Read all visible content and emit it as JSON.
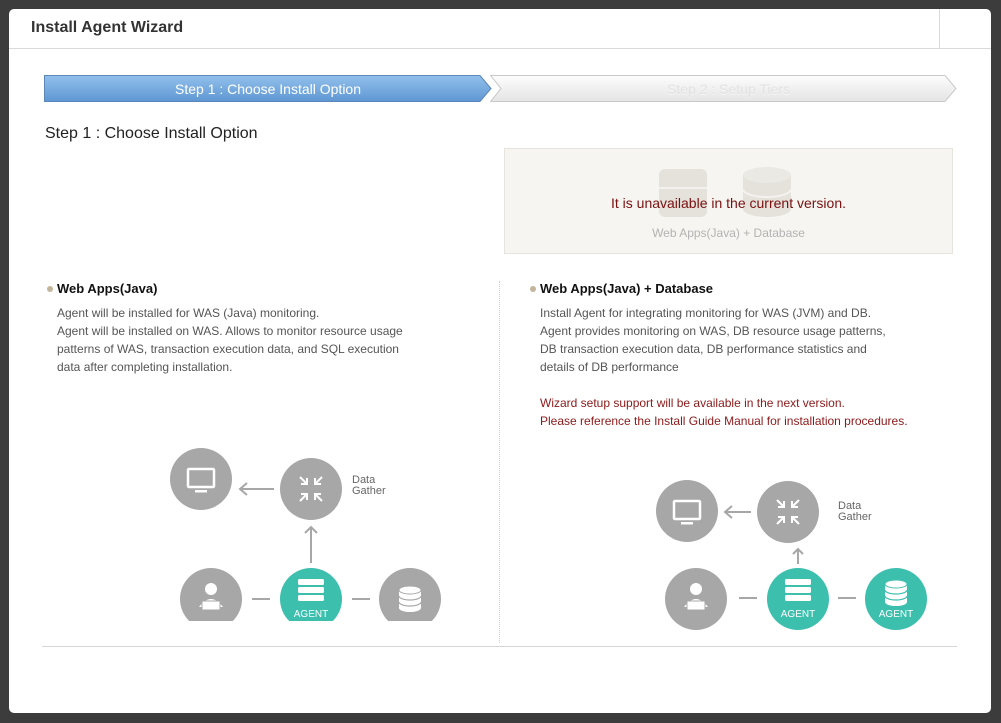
{
  "window": {
    "title": "Install Agent Wizard"
  },
  "steps": [
    {
      "label": "Step 1 : Choose Install Option",
      "active": true
    },
    {
      "label": "Step 2 : Setup Tiers",
      "active": false
    }
  ],
  "heading": "Step 1 : Choose Install Option",
  "unavailable": {
    "message": "It is unavailable in the current version.",
    "sub_label": "Web Apps(Java)  + Database"
  },
  "left": {
    "title": "Web Apps(Java)",
    "lines": [
      "Agent will be installed for WAS (Java) monitoring.",
      "Agent will be installed on WAS. Allows to monitor resource usage",
      "patterns of WAS, transaction execution data, and SQL execution",
      "data after completing installation."
    ],
    "diagram": {
      "gather_line1": "Data",
      "gather_line2": "Gather",
      "agent_label": "AGENT"
    }
  },
  "right": {
    "title": "Web Apps(Java) + Database",
    "lines": [
      "Install Agent for integrating monitoring for WAS (JVM) and DB.",
      "Agent provides monitoring on WAS, DB resource usage patterns,",
      "DB transaction execution data, DB performance statistics and",
      "details of DB performance"
    ],
    "notes": [
      "Wizard setup support will be available in the next version.",
      "Please reference the Install Guide Manual for installation procedures."
    ],
    "diagram": {
      "gather_line1": "Data",
      "gather_line2": "Gather",
      "agent_label": "AGENT",
      "db_agent_label": "AGENT"
    }
  },
  "colors": {
    "teal": "#3dbfae",
    "gray_circle": "#a7a7a7",
    "step_active": "#6ea6dc",
    "error_text": "#7a1010"
  }
}
